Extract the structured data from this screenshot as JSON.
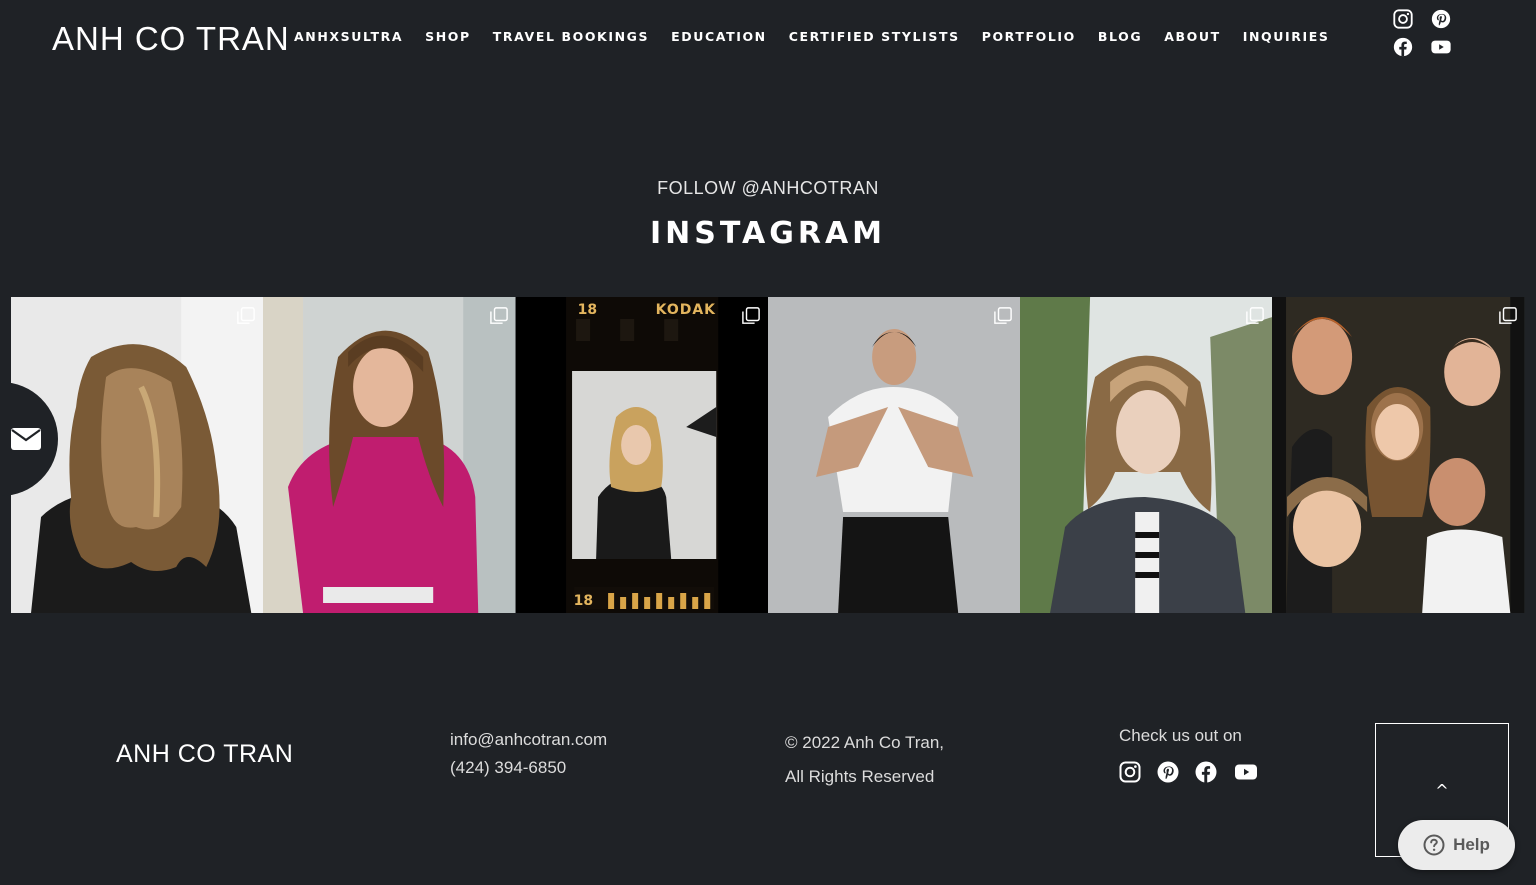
{
  "header": {
    "logo": "ANH CO TRAN",
    "nav": [
      "ANHXSULTRA",
      "SHOP",
      "TRAVEL BOOKINGS",
      "EDUCATION",
      "CERTIFIED STYLISTS",
      "PORTFOLIO",
      "BLOG",
      "ABOUT",
      "INQUIRIES"
    ],
    "social_icons": [
      "instagram-icon",
      "pinterest-icon",
      "facebook-icon",
      "youtube-icon"
    ]
  },
  "side_tab": {
    "icon": "envelope-icon"
  },
  "instagram": {
    "follow": "FOLLOW @ANHCOTRAN",
    "title": "INSTAGRAM",
    "film_labels": {
      "frame": "18",
      "brand": "KODAK",
      "frame_bottom": "18"
    }
  },
  "footer": {
    "logo": "ANH CO TRAN",
    "email": "info@anhcotran.com",
    "phone": "(424) 394-6850",
    "copyright_line1": "© 2022 Anh Co Tran,",
    "copyright_line2": "All Rights Reserved",
    "check_us": "Check us out on",
    "scroll_top": "^",
    "help": "Help"
  },
  "colors": {
    "background": "#1f2226",
    "text": "#ffffff",
    "help_bg": "#ececec"
  }
}
